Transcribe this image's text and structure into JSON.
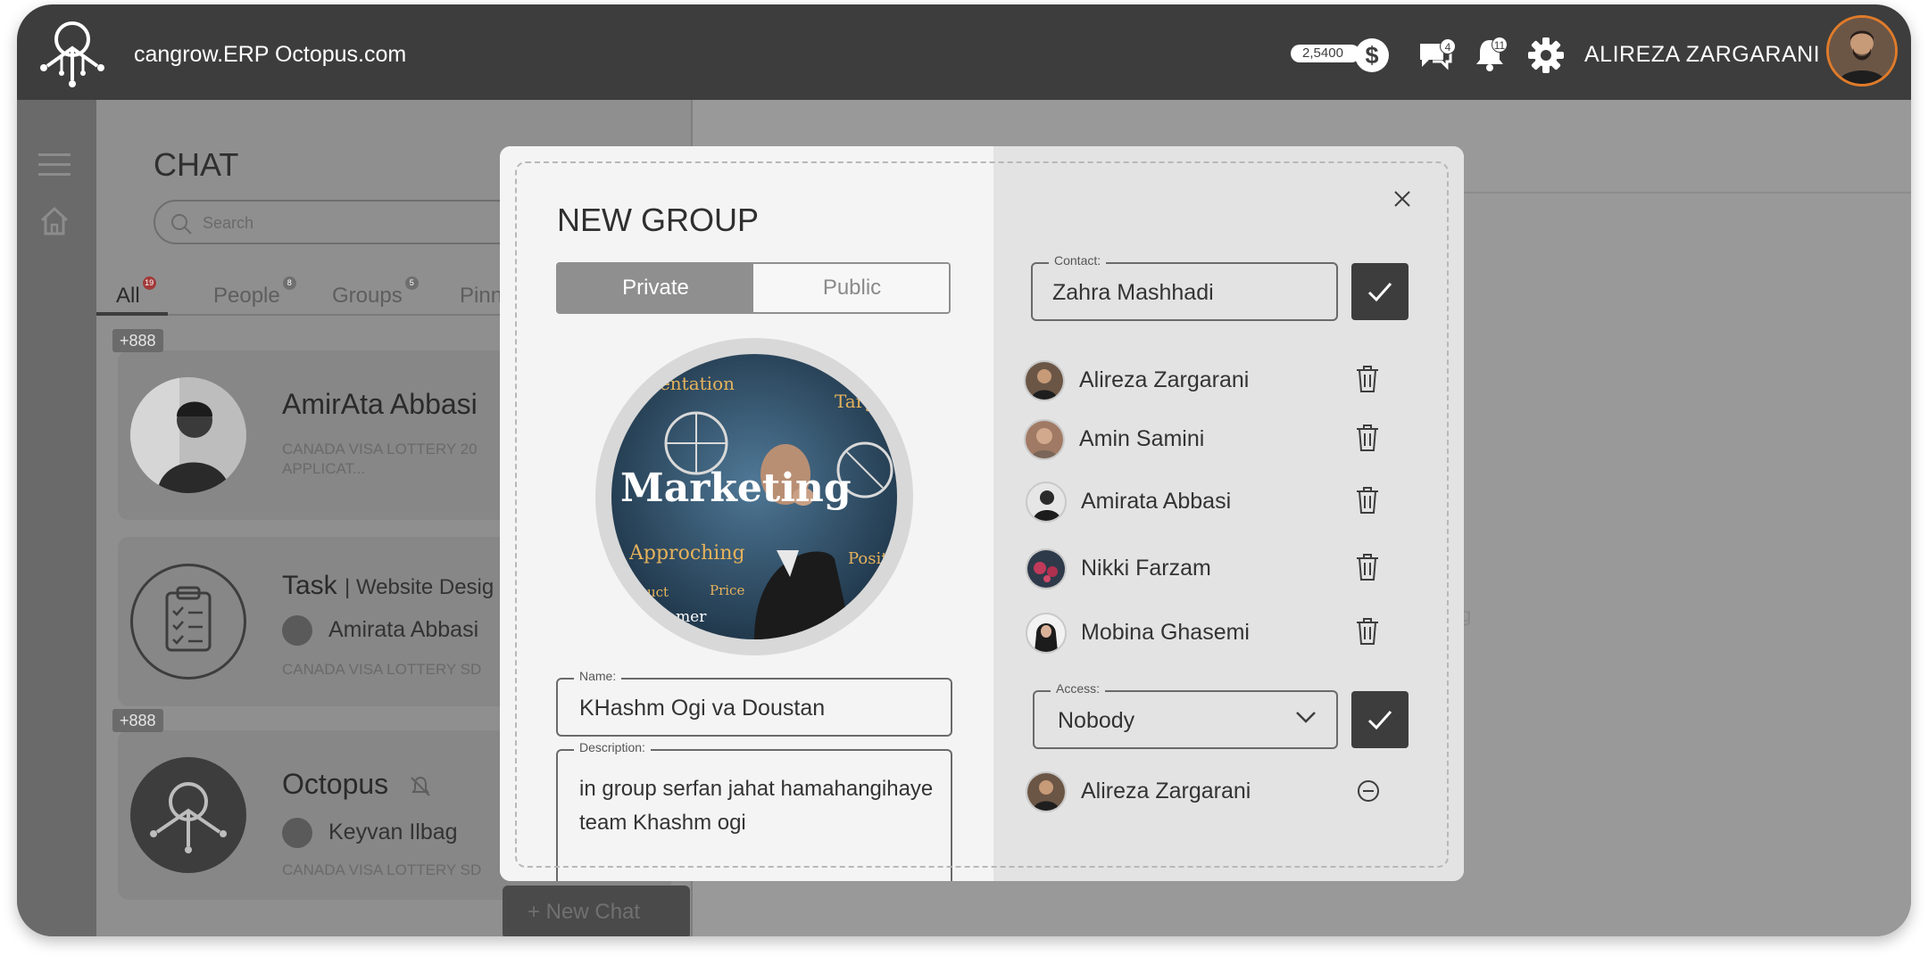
{
  "topbar": {
    "site_title": "cangrow.ERP Octopus.com",
    "wallet_amount": "2,5400",
    "wallet_currency_symbol": "$",
    "messages_badge": "4",
    "notifications_badge": "11",
    "user_name": "ALIREZA ZARGARANI"
  },
  "chat": {
    "title": "CHAT",
    "search_placeholder": "Search",
    "tabs": [
      {
        "label": "All",
        "badge": "19"
      },
      {
        "label": "People",
        "badge": "8"
      },
      {
        "label": "Groups",
        "badge": "5"
      },
      {
        "label": "Pinn",
        "badge": ""
      }
    ],
    "cards": [
      {
        "count": "+888",
        "name": "AmirAta Abbasi",
        "subtitle": "CANADA  VISA LOTTERY 20\nAPPLICAT..."
      },
      {
        "task_label": "Task",
        "task_title": "Website Desig",
        "person": "Amirata Abbasi",
        "subtitle": "CANADA  VISA LOTTERY SD"
      },
      {
        "count": "+888",
        "name": "Octopus",
        "person": "Keyvan Ilbag",
        "subtitle": "CANADA  VISA LOTTERY SD"
      }
    ],
    "new_chat_label": "+ New Chat"
  },
  "main": {
    "ghost_text": "g"
  },
  "modal": {
    "title": "NEW GROUP",
    "privacy_options": [
      "Private",
      "Public"
    ],
    "privacy_selected": "Private",
    "photo_caption_words": [
      "Marketing",
      "Approching",
      "mentation",
      "Targ",
      "Price",
      "uct",
      "tomer",
      "Posit"
    ],
    "name_label": "Name:",
    "name_value": "KHashm Ogi va Doustan",
    "description_label": "Description:",
    "description_value": "in group serfan jahat hamahangihaye team Khashm ogi",
    "contact_label": "Contact:",
    "contact_value": "Zahra Mashhadi",
    "members": [
      {
        "name": "Alireza Zargarani"
      },
      {
        "name": "Amin Samini"
      },
      {
        "name": "Amirata Abbasi"
      },
      {
        "name": "Nikki Farzam"
      },
      {
        "name": "Mobina Ghasemi"
      }
    ],
    "access_label": "Access:",
    "access_value": "Nobody",
    "access_members": [
      {
        "name": "Alireza Zargarani"
      }
    ]
  },
  "colors": {
    "topbar": "#3d3d3d",
    "overlay": "#9a9a9a",
    "modal_left": "#f4f4f4",
    "modal_right": "#e3e3e3",
    "accent_dark": "#3d3d3d",
    "segment_active": "#8f8f8f"
  }
}
